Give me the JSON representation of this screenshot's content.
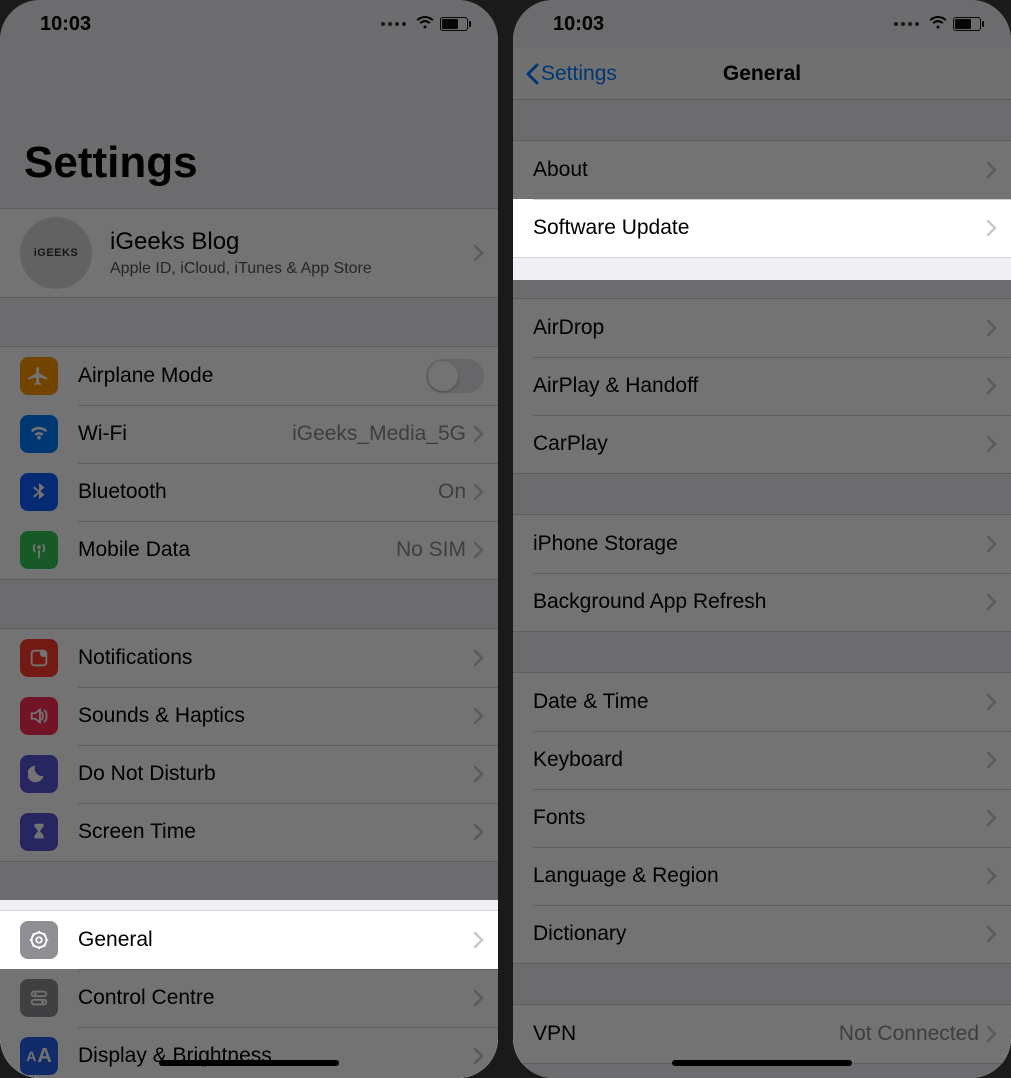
{
  "statusbar": {
    "time": "10:03"
  },
  "left": {
    "title": "Settings",
    "account": {
      "avatar_text": "iGEEKS",
      "name": "iGeeks Blog",
      "subtitle": "Apple ID, iCloud, iTunes & App Store"
    },
    "group1": [
      {
        "icon": "airplane",
        "label": "Airplane Mode",
        "value": "",
        "toggle": true
      },
      {
        "icon": "wifi",
        "label": "Wi-Fi",
        "value": "iGeeks_Media_5G"
      },
      {
        "icon": "bluetooth",
        "label": "Bluetooth",
        "value": "On"
      },
      {
        "icon": "mobiledata",
        "label": "Mobile Data",
        "value": "No SIM"
      }
    ],
    "group2": [
      {
        "icon": "notifications",
        "label": "Notifications"
      },
      {
        "icon": "sounds",
        "label": "Sounds & Haptics"
      },
      {
        "icon": "dnd",
        "label": "Do Not Disturb"
      },
      {
        "icon": "screentime",
        "label": "Screen Time"
      }
    ],
    "group3": [
      {
        "icon": "general",
        "label": "General",
        "highlight": true
      },
      {
        "icon": "controlcentre",
        "label": "Control Centre"
      },
      {
        "icon": "display",
        "label": "Display & Brightness"
      }
    ]
  },
  "right": {
    "back": "Settings",
    "title": "General",
    "g1": [
      {
        "label": "About"
      },
      {
        "label": "Software Update",
        "highlight": true
      }
    ],
    "g2": [
      {
        "label": "AirDrop"
      },
      {
        "label": "AirPlay & Handoff"
      },
      {
        "label": "CarPlay"
      }
    ],
    "g3": [
      {
        "label": "iPhone Storage"
      },
      {
        "label": "Background App Refresh"
      }
    ],
    "g4": [
      {
        "label": "Date & Time"
      },
      {
        "label": "Keyboard"
      },
      {
        "label": "Fonts"
      },
      {
        "label": "Language & Region"
      },
      {
        "label": "Dictionary"
      }
    ],
    "g5": [
      {
        "label": "VPN",
        "value": "Not Connected"
      }
    ]
  }
}
